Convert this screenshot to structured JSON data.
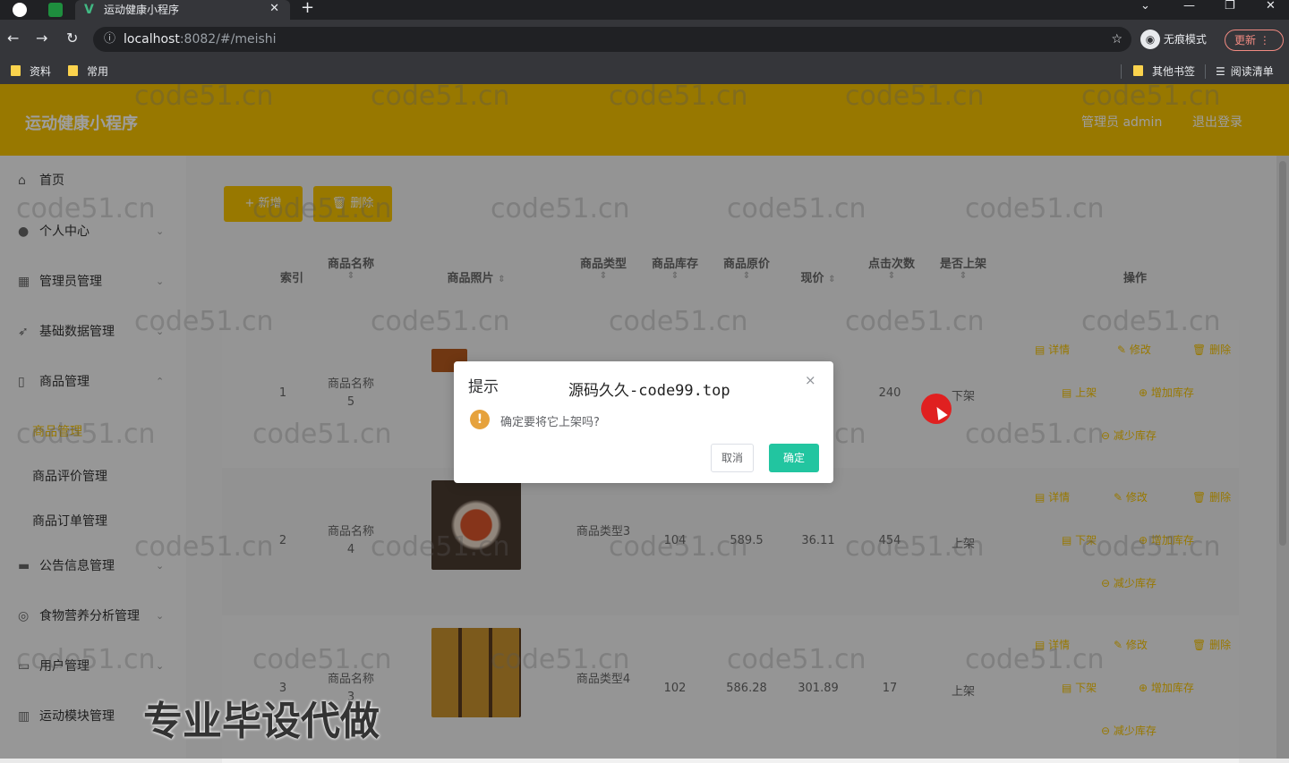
{
  "browser": {
    "tab_title": "运动健康小程序",
    "tab_close": "✕",
    "new_tab": "+",
    "url_host": "localhost",
    "url_rest": ":8082/#/meishi",
    "incognito_label": "无痕模式",
    "update_label": "更新",
    "bookmarks": [
      "资料",
      "常用"
    ],
    "bookmarks_right": [
      "其他书签",
      "阅读清单"
    ]
  },
  "app": {
    "title": "运动健康小程序",
    "user_label": "管理员 admin",
    "logout_label": "退出登录"
  },
  "sidebar": {
    "items": [
      {
        "label": "首页",
        "icon": "home-icon"
      },
      {
        "label": "个人中心",
        "icon": "user-icon"
      },
      {
        "label": "管理员管理",
        "icon": "grid-icon"
      },
      {
        "label": "基础数据管理",
        "icon": "send-icon"
      },
      {
        "label": "商品管理",
        "icon": "phone-icon"
      },
      {
        "label": "公告信息管理",
        "icon": "message-icon"
      },
      {
        "label": "食物营养分析管理",
        "icon": "compass-icon"
      },
      {
        "label": "用户管理",
        "icon": "monitor-icon"
      },
      {
        "label": "运动模块管理",
        "icon": "chart-icon"
      }
    ],
    "sub_items": [
      "商品管理",
      "商品评价管理",
      "商品订单管理"
    ]
  },
  "toolbar": {
    "add_label": "+ 新增",
    "delete_label": "删除"
  },
  "table": {
    "headers": [
      "索引",
      "商品名称",
      "商品照片",
      "商品类型",
      "商品库存",
      "商品原价",
      "现价",
      "点击次数",
      "是否上架",
      "操作"
    ],
    "rows": [
      {
        "index": "1",
        "name": "商品名称5",
        "type": "",
        "stock": "",
        "orig": "",
        "price": "",
        "clicks": "240",
        "on_sale": "下架",
        "toggle": "上架"
      },
      {
        "index": "2",
        "name": "商品名称4",
        "type": "商品类型3",
        "stock": "104",
        "orig": "589.5",
        "price": "36.11",
        "clicks": "454",
        "on_sale": "上架",
        "toggle": "下架"
      },
      {
        "index": "3",
        "name": "商品名称3",
        "type": "商品类型4",
        "stock": "102",
        "orig": "586.28",
        "price": "301.89",
        "clicks": "17",
        "on_sale": "上架",
        "toggle": "下架"
      }
    ],
    "ops": {
      "detail": "详情",
      "edit": "修改",
      "delete": "删除",
      "add_stock": "增加库存",
      "reduce_stock": "减少库存"
    }
  },
  "dialog": {
    "title": "提示",
    "brand": "源码久久-code99.top",
    "message": "确定要将它上架吗?",
    "cancel": "取消",
    "confirm": "确定",
    "close": "×"
  },
  "watermark": "code51.cn",
  "overlay_text": "专业毕设代做",
  "colors": {
    "accent": "#f5c200",
    "confirm": "#22c5a0",
    "warn": "#e6a23c"
  }
}
